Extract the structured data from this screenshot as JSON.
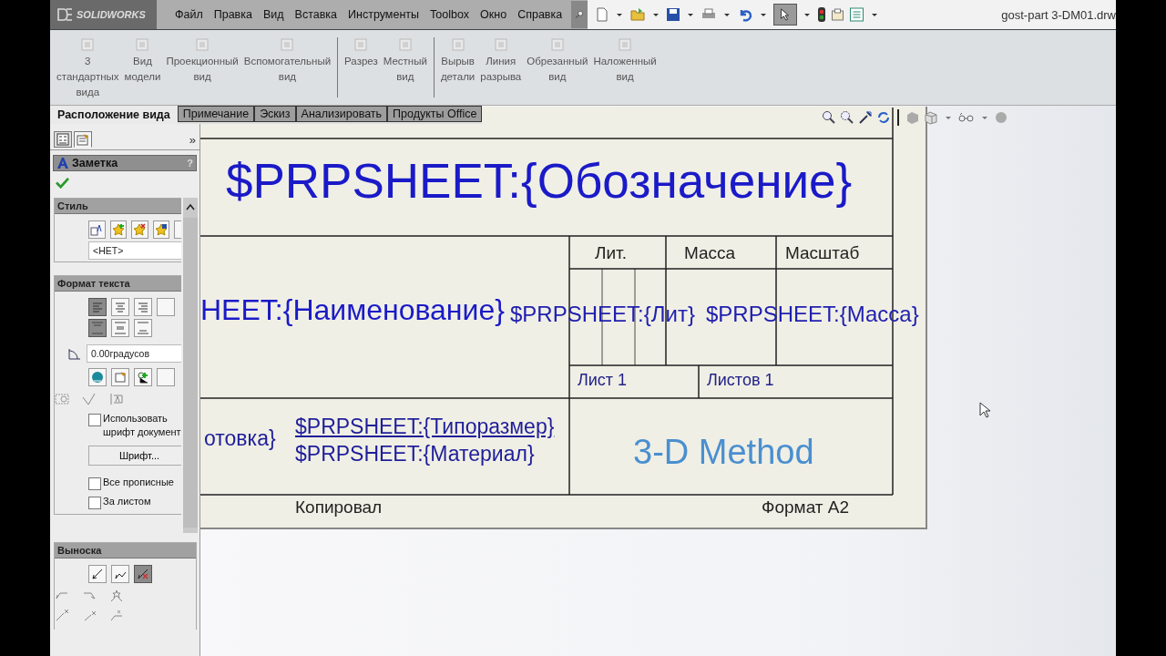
{
  "app": {
    "logo": "SOLIDWORKS"
  },
  "menu": [
    "Файл",
    "Правка",
    "Вид",
    "Вставка",
    "Инструменты",
    "Toolbox",
    "Окно",
    "Справка"
  ],
  "document_title": "gost-part 3-DM01.drw",
  "ribbon": {
    "groups": [
      {
        "commands": [
          {
            "label": "3\nстандартных\nвида"
          },
          {
            "label": "Вид\nмодели"
          },
          {
            "label": "Проекционный\nвид"
          },
          {
            "label": "Вспомогательный\nвид"
          }
        ]
      },
      {
        "commands": [
          {
            "label": "Разрез"
          },
          {
            "label": "Местный\nвид"
          }
        ]
      },
      {
        "commands": [
          {
            "label": "Вырыв\nдетали"
          },
          {
            "label": "Линия\nразрыва"
          },
          {
            "label": "Обрезанный\nвид"
          },
          {
            "label": "Наложенный\nвид"
          }
        ]
      }
    ]
  },
  "tabs": [
    {
      "label": "Расположение вида",
      "selected": true
    },
    {
      "label": "Примечание",
      "selected": false
    },
    {
      "label": "Эскиз",
      "selected": false
    },
    {
      "label": "Анализировать",
      "selected": false
    },
    {
      "label": "Продукты Office",
      "selected": false
    }
  ],
  "property_manager": {
    "title": "Заметка",
    "help": "?",
    "collapse": "»",
    "style_group": {
      "title": "Стиль",
      "value": "<НЕТ>"
    },
    "text_format_group": {
      "title": "Формат текста",
      "horizontal_align": [
        {
          "selected": true
        },
        {
          "selected": false
        },
        {
          "selected": false
        }
      ],
      "vertical_align": [
        {
          "selected": true
        },
        {
          "selected": false
        },
        {
          "selected": false
        }
      ],
      "angle": "0.00градусов",
      "font_button": "Шрифт...",
      "options": [
        {
          "label": "Использовать шрифт документ",
          "checked": false,
          "kind": "before"
        },
        {
          "label": "Все прописные",
          "checked": false,
          "kind": "after"
        },
        {
          "label": "За листом",
          "checked": false,
          "kind": "after"
        }
      ]
    },
    "leader_group": {
      "title": "Выноска",
      "leader_styles": [
        {
          "selected": false
        },
        {
          "selected": false
        },
        {
          "selected": true
        }
      ]
    }
  },
  "drawing": {
    "designation": "$PRPSHEET:{Обозначение}",
    "name": "HEET:{Наименование}",
    "headers": [
      "Лит.",
      "Масса",
      "Масштаб"
    ],
    "lit_value": "$PRPSHEET:{Лит}",
    "mass_value": "$PRPSHEET:{Масса}",
    "sheet": "Лист 1",
    "sheets": "Листов 1",
    "blank_fragment": "отовка}",
    "size": "$PRPSHEET:{Типоразмер}",
    "material": "$PRPSHEET:{Материал}",
    "company": "3-D Method",
    "copied": "Копировал",
    "format": "Формат А2"
  }
}
